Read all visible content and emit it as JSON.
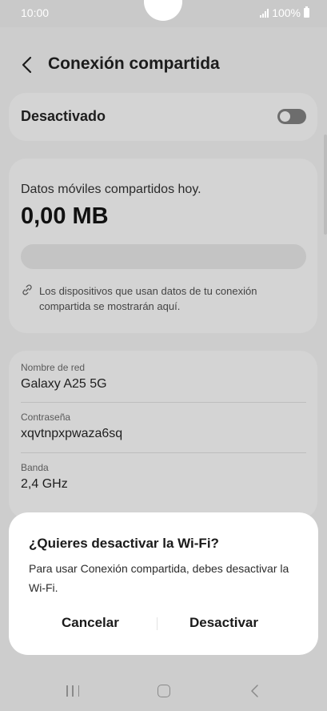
{
  "status_bar": {
    "time": "10:00",
    "battery": "100%"
  },
  "header": {
    "title": "Conexión compartida"
  },
  "toggle_card": {
    "label": "Desactivado",
    "state": "off"
  },
  "usage": {
    "label": "Datos móviles compartidos hoy.",
    "value": "0,00 MB",
    "progress": 0,
    "note": "Los dispositivos que usan datos de tu conexión compartida se mostrarán aquí."
  },
  "network": {
    "name_label": "Nombre de red",
    "name_value": "Galaxy A25 5G",
    "password_label": "Contraseña",
    "password_value": "xqvtnpxpwaza6sq",
    "band_label": "Banda",
    "band_value": "2,4 GHz"
  },
  "dialog": {
    "title": "¿Quieres desactivar la Wi-Fi?",
    "message": "Para usar Conexión compartida, debes desactivar la Wi-Fi.",
    "cancel_label": "Cancelar",
    "confirm_label": "Desactivar"
  },
  "colors": {
    "scrim": "#cdcdcd",
    "dialog_bg": "#ffffff",
    "toggle_off": "#6d6d6d"
  }
}
